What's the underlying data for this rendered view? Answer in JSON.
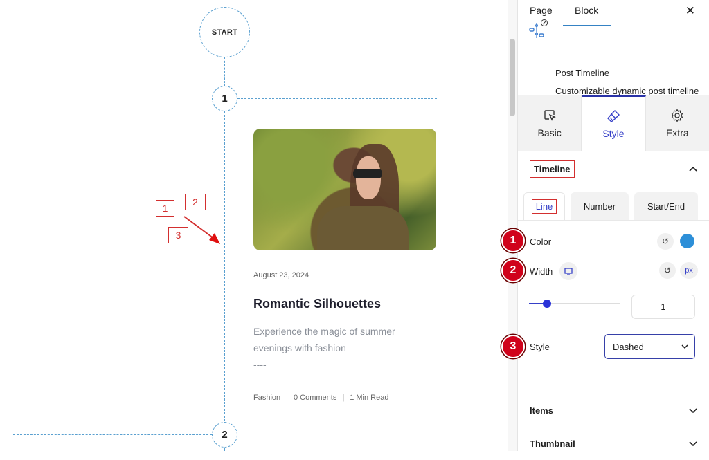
{
  "timeline": {
    "start_label": "START",
    "numbers": [
      "1",
      "2"
    ],
    "line_color": "#5aa0d0",
    "post": {
      "date": "August 23, 2024",
      "title": "Romantic Silhouettes",
      "excerpt": "Experience the magic of summer evenings with fashion",
      "excerpt_suffix": "----",
      "category": "Fashion",
      "separator": "|",
      "comments": "0 Comments",
      "read_time": "1 Min Read"
    }
  },
  "annotations": {
    "boxes": [
      "1",
      "2",
      "3"
    ],
    "badges": [
      "1",
      "2",
      "3"
    ],
    "color": "#d32f2f"
  },
  "panel": {
    "tabs": [
      {
        "label": "Page"
      },
      {
        "label": "Block",
        "active": true
      }
    ],
    "close_label": "✕",
    "block": {
      "name": "Post Timeline",
      "description": "Customizable dynamic post timeline for your website posts"
    },
    "style_tabs": [
      {
        "label": "Basic",
        "icon": "cursor-select-icon"
      },
      {
        "label": "Style",
        "icon": "paintbrush-icon",
        "active": true
      },
      {
        "label": "Extra",
        "icon": "gear-icon"
      }
    ],
    "timeline_section": {
      "title": "Timeline",
      "expanded": true,
      "sub_tabs": [
        {
          "label": "Line",
          "active": true
        },
        {
          "label": "Number"
        },
        {
          "label": "Start/End"
        }
      ],
      "color": {
        "label": "Color",
        "value": "#2d8fd8"
      },
      "width": {
        "label": "Width",
        "unit": "px",
        "value": "1",
        "slider_fraction": 0.2
      },
      "style": {
        "label": "Style",
        "value": "Dashed"
      }
    },
    "sections": [
      {
        "title": "Items",
        "expanded": false
      },
      {
        "title": "Thumbnail",
        "expanded": false
      }
    ]
  }
}
